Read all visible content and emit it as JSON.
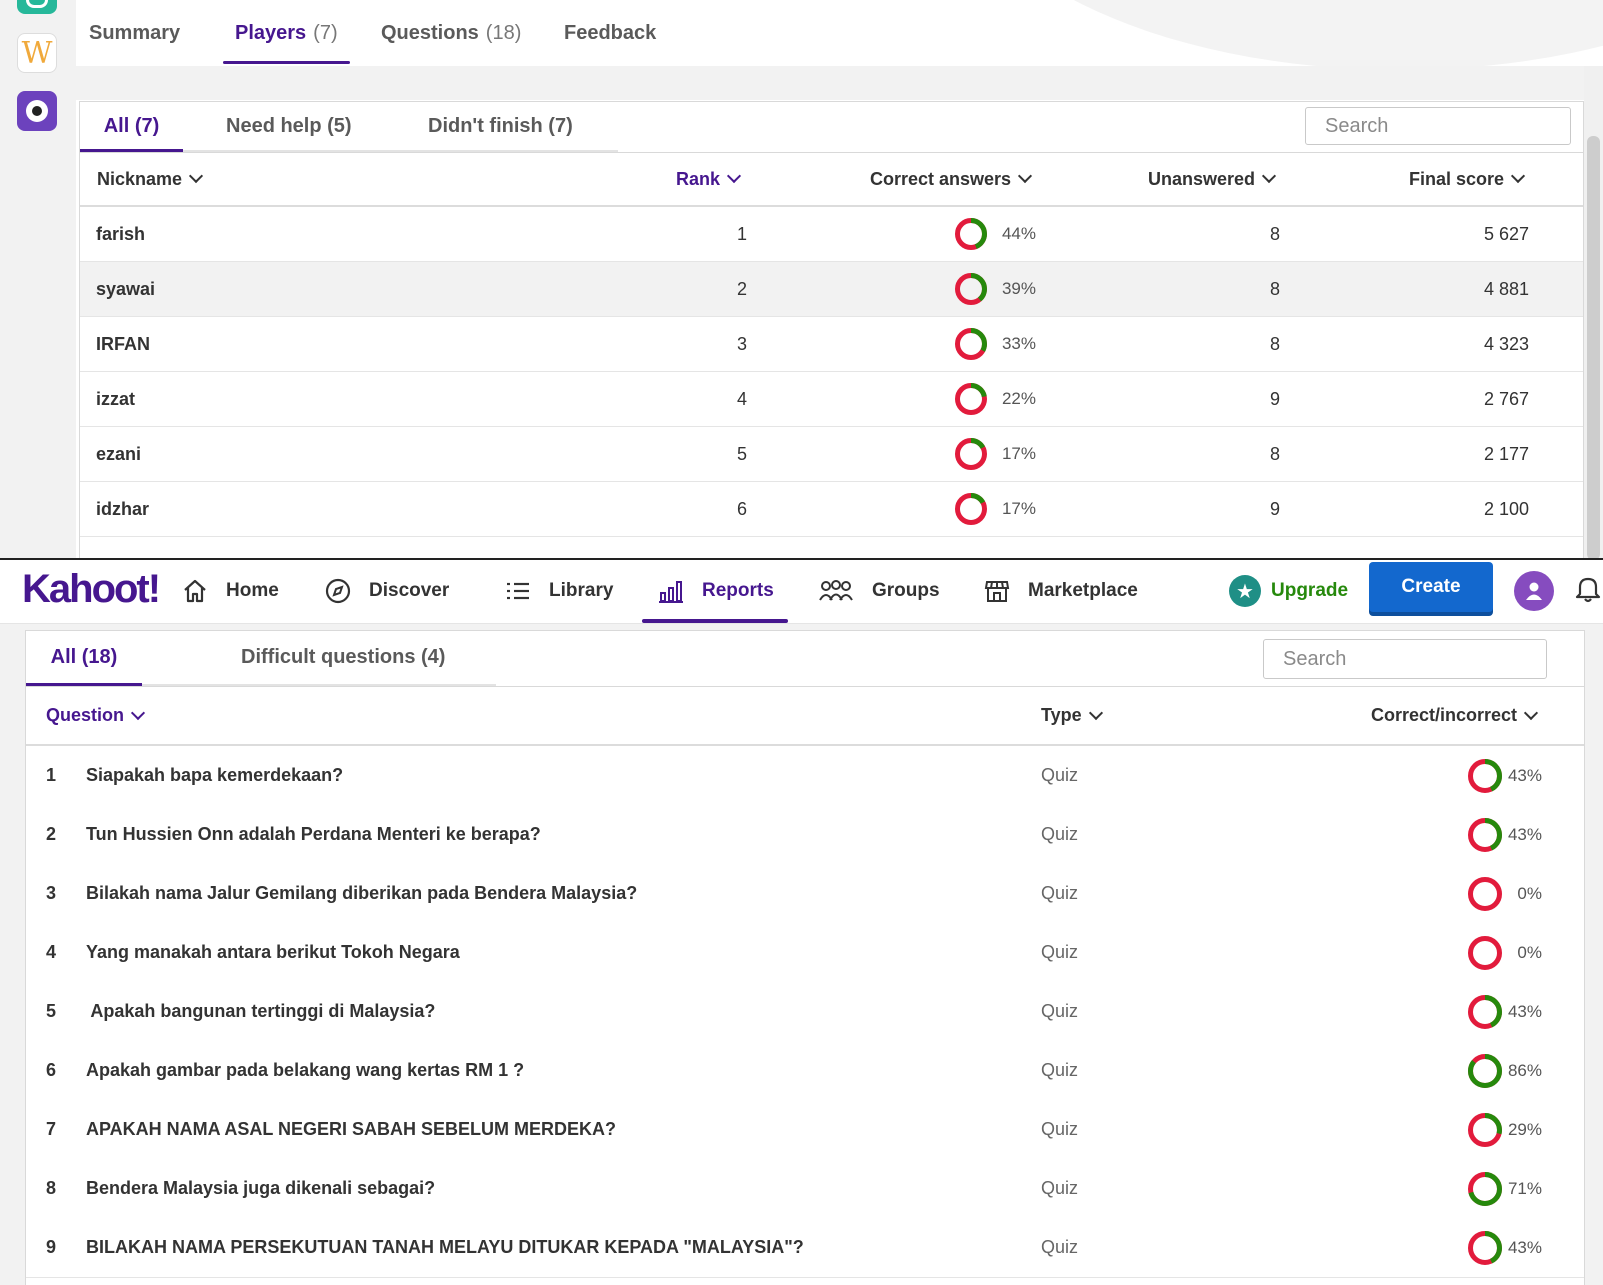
{
  "colors": {
    "brand": "#46178f",
    "correct": "#26890c",
    "incorrect": "#e21b3c",
    "create": "#1368ce"
  },
  "top": {
    "tabs": [
      {
        "label": "Summary",
        "count": ""
      },
      {
        "label": "Players",
        "count": "(7)"
      },
      {
        "label": "Questions",
        "count": "(18)"
      },
      {
        "label": "Feedback",
        "count": ""
      }
    ],
    "subtabs": [
      "All (7)",
      "Need help (5)",
      "Didn't finish (7)"
    ],
    "search_placeholder": "Search",
    "columns": [
      "Nickname",
      "Rank",
      "Correct answers",
      "Unanswered",
      "Final score"
    ],
    "rows": [
      {
        "nickname": "farish",
        "rank": "1",
        "correct_pct": 44,
        "correct": "44%",
        "unanswered": "8",
        "score": "5 627"
      },
      {
        "nickname": "syawai",
        "rank": "2",
        "correct_pct": 39,
        "correct": "39%",
        "unanswered": "8",
        "score": "4 881"
      },
      {
        "nickname": "IRFAN",
        "rank": "3",
        "correct_pct": 33,
        "correct": "33%",
        "unanswered": "8",
        "score": "4 323"
      },
      {
        "nickname": "izzat",
        "rank": "4",
        "correct_pct": 22,
        "correct": "22%",
        "unanswered": "9",
        "score": "2 767"
      },
      {
        "nickname": "ezani",
        "rank": "5",
        "correct_pct": 17,
        "correct": "17%",
        "unanswered": "8",
        "score": "2 177"
      },
      {
        "nickname": "idzhar",
        "rank": "6",
        "correct_pct": 17,
        "correct": "17%",
        "unanswered": "9",
        "score": "2 100"
      }
    ]
  },
  "nav": {
    "logo": "Kahoot!",
    "items": [
      {
        "label": "Home",
        "icon": "home-icon"
      },
      {
        "label": "Discover",
        "icon": "compass-icon"
      },
      {
        "label": "Library",
        "icon": "list-icon"
      },
      {
        "label": "Reports",
        "icon": "bar-chart-icon"
      },
      {
        "label": "Groups",
        "icon": "group-icon"
      },
      {
        "label": "Marketplace",
        "icon": "store-icon"
      }
    ],
    "upgrade": "Upgrade",
    "create": "Create"
  },
  "bottom": {
    "subtabs": [
      "All (18)",
      "Difficult questions (4)"
    ],
    "search_placeholder": "Search",
    "columns": [
      "Question",
      "Type",
      "Correct/incorrect"
    ],
    "rows": [
      {
        "num": "1",
        "text": "Siapakah bapa kemerdekaan?",
        "type": "Quiz",
        "pct": 43,
        "label": "43%"
      },
      {
        "num": "2",
        "text": "Tun Hussien Onn adalah Perdana Menteri ke berapa?",
        "type": "Quiz",
        "pct": 43,
        "label": "43%"
      },
      {
        "num": "3",
        "text": "Bilakah nama Jalur Gemilang diberikan pada Bendera Malaysia?",
        "type": "Quiz",
        "pct": 0,
        "label": "0%"
      },
      {
        "num": "4",
        "text": "Yang manakah antara berikut Tokoh Negara",
        "type": "Quiz",
        "pct": 0,
        "label": "0%"
      },
      {
        "num": "5",
        "text": " Apakah bangunan tertinggi di Malaysia?",
        "type": "Quiz",
        "pct": 43,
        "label": "43%"
      },
      {
        "num": "6",
        "text": "Apakah gambar pada belakang wang kertas RM 1 ?",
        "type": "Quiz",
        "pct": 86,
        "label": "86%"
      },
      {
        "num": "7",
        "text": "APAKAH NAMA ASAL NEGERI SABAH SEBELUM MERDEKA?",
        "type": "Quiz",
        "pct": 29,
        "label": "29%"
      },
      {
        "num": "8",
        "text": "Bendera Malaysia juga dikenali sebagai?",
        "type": "Quiz",
        "pct": 71,
        "label": "71%"
      },
      {
        "num": "9",
        "text": "BILAKAH NAMA PERSEKUTUAN TANAH MELAYU DITUKAR KEPADA \"MALAYSIA\"?",
        "type": "Quiz",
        "pct": 43,
        "label": "43%"
      }
    ]
  }
}
